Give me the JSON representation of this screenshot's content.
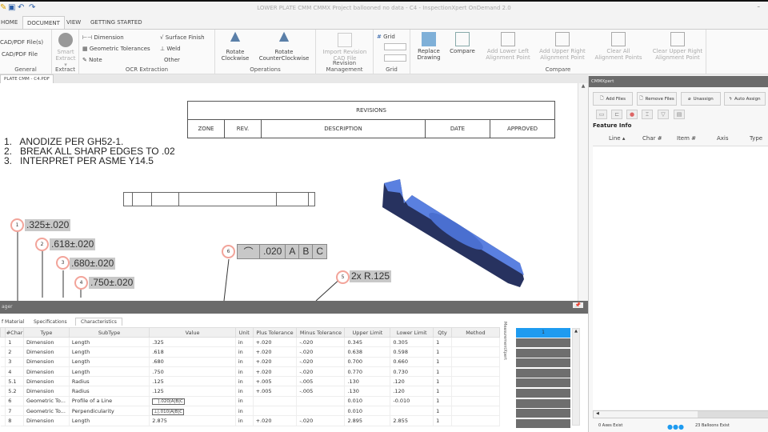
{
  "window": {
    "title": "LOWER PLATE CMM CMMX Project ballooned no data - C4 - InspectionXpert OnDemand 2.0"
  },
  "menu_tabs": [
    "HOME",
    "DOCUMENT",
    "VIEW",
    "GETTING STARTED"
  ],
  "ribbon": {
    "general": {
      "items": [
        "CAD/PDF File(s)",
        "CAD/PDF File"
      ],
      "label": "General"
    },
    "extract": {
      "button": "Smart Extract",
      "label": "Extract"
    },
    "ocr": {
      "items": [
        "Dimension",
        "Geometric Tolerances",
        "Note",
        "Surface Finish",
        "Weld",
        "Other"
      ],
      "label": "OCR Extraction"
    },
    "operations": {
      "items": [
        "Rotate Clockwise",
        "Rotate CounterClockwise"
      ],
      "label": "Operations"
    },
    "revision": {
      "items": [
        "Import Revision CAD File"
      ],
      "label": "Revision Management"
    },
    "grid": {
      "items": [
        "Grid"
      ],
      "label": "Grid"
    },
    "compare": {
      "items": [
        "Replace Drawing",
        "Compare",
        "Add Lower Left Alignment Point",
        "Add Upper Right Alignment Point",
        "Clear All Alignment Points",
        "Clear Upper Right Alignment Point"
      ],
      "label": "Compare"
    }
  },
  "document_tab": "PLATE CMM - C4.PDF",
  "drawing": {
    "revisions": {
      "title": "REVISIONS",
      "columns": [
        "ZONE",
        "REV.",
        "DESCRIPTION",
        "DATE",
        "APPROVED"
      ]
    },
    "notes": [
      "1.   ANODIZE PER GH52-1.",
      "2.   BREAK ALL SHARP EDGES TO .02",
      "3.   INTERPRET PER ASME Y14.5"
    ],
    "balloons": [
      {
        "n": "1",
        "text": ".325±.020"
      },
      {
        "n": "2",
        "text": ".618±.020"
      },
      {
        "n": "3",
        "text": ".680±.020"
      },
      {
        "n": "4",
        "text": ".750±.020"
      },
      {
        "n": "5",
        "text": "2x R.125"
      },
      {
        "n": "6",
        "text": ".020",
        "datums": [
          "A",
          "B",
          "C"
        ]
      }
    ]
  },
  "bottom_panel": {
    "title": "ager",
    "tabs": [
      "f Material",
      "Specifications",
      "Characteristics"
    ],
    "columns": [
      "#Char",
      "Type",
      "SubType",
      "Value",
      "Unit",
      "Plus Tolerance",
      "Minus Tolerance",
      "Upper Limit",
      "Lower Limit",
      "Qty",
      "Method"
    ],
    "rows": [
      [
        "1",
        "Dimension",
        "Length",
        ".325",
        "in",
        "+.020",
        "-.020",
        "0.345",
        "0.305",
        "1",
        ""
      ],
      [
        "2",
        "Dimension",
        "Length",
        ".618",
        "in",
        "+.020",
        "-.020",
        "0.638",
        "0.598",
        "1",
        ""
      ],
      [
        "3",
        "Dimension",
        "Length",
        ".680",
        "in",
        "+.020",
        "-.020",
        "0.700",
        "0.660",
        "1",
        ""
      ],
      [
        "4",
        "Dimension",
        "Length",
        ".750",
        "in",
        "+.020",
        "-.020",
        "0.770",
        "0.730",
        "1",
        ""
      ],
      [
        "5.1",
        "Dimension",
        "Radius",
        ".125",
        "in",
        "+.005",
        "-.005",
        ".130",
        ".120",
        "1",
        ""
      ],
      [
        "5.2",
        "Dimension",
        "Radius",
        ".125",
        "in",
        "+.005",
        "-.005",
        ".130",
        ".120",
        "1",
        ""
      ],
      [
        "6",
        "Geometric To...",
        "Profile of a Line",
        "⌒|.020|A|B|C",
        "in",
        "",
        "",
        "0.010",
        "-0.010",
        "1",
        ""
      ],
      [
        "7",
        "Geometric To...",
        "Perpendicularity",
        "⊥|.010|A|B|C",
        "in",
        "",
        "",
        "0.010",
        "",
        "1",
        ""
      ],
      [
        "8",
        "Dimension",
        "Length",
        "2.875",
        "in",
        "+.020",
        "-.020",
        "2.895",
        "2.855",
        "1",
        ""
      ]
    ],
    "side_label": "MeasurementXpert",
    "list_selected": "1"
  },
  "cmmxpert": {
    "title": "CMMXpert",
    "buttons": [
      "Add Files",
      "Remove Files",
      "Unassign",
      "Auto Assign"
    ],
    "section": "Feature Info",
    "columns": [
      "Line",
      "Char #",
      "Item #",
      "Axis",
      "Type"
    ],
    "status_left": "0 Axes Exist",
    "status_right": "23 Balloons Exist"
  },
  "colors": {
    "accent": "#1e9bf0",
    "balloon": "#f2a49a",
    "part": "#4a6fd0",
    "panel_header": "#6b6b6b"
  }
}
